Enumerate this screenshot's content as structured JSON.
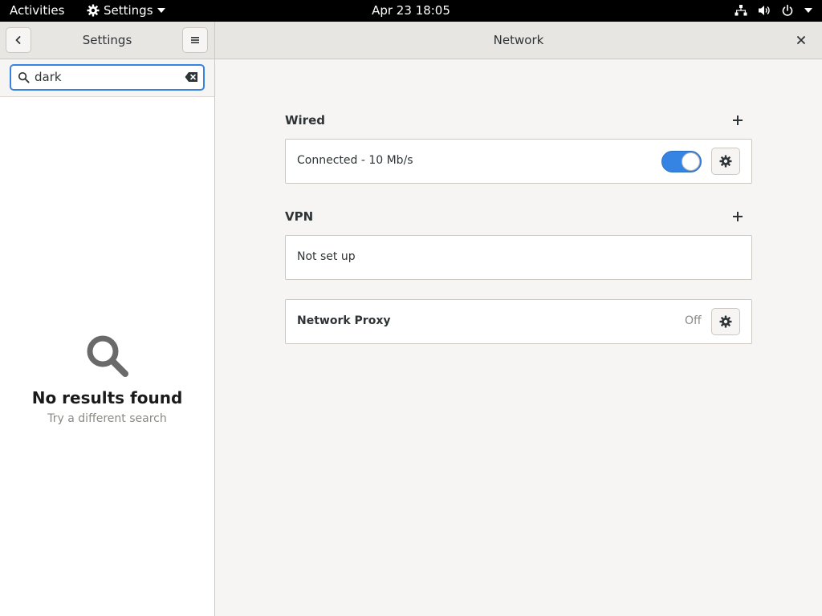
{
  "topbar": {
    "activities": "Activities",
    "app_name": "Settings",
    "clock": "Apr 23  18:05",
    "tray_icons": [
      "network-wired-icon",
      "volume-icon",
      "power-icon"
    ]
  },
  "sidebar": {
    "title": "Settings",
    "search": {
      "value": "dark",
      "placeholder": ""
    },
    "empty": {
      "heading": "No results found",
      "subtitle": "Try a different search"
    }
  },
  "content": {
    "title": "Network",
    "wired": {
      "label": "Wired",
      "status": "Connected - 10 Mb/s",
      "switch_on": true
    },
    "vpn": {
      "label": "VPN",
      "status": "Not set up"
    },
    "proxy": {
      "label": "Network Proxy",
      "value": "Off"
    }
  },
  "colors": {
    "accent": "#3584e4",
    "topbar": "#000000"
  }
}
